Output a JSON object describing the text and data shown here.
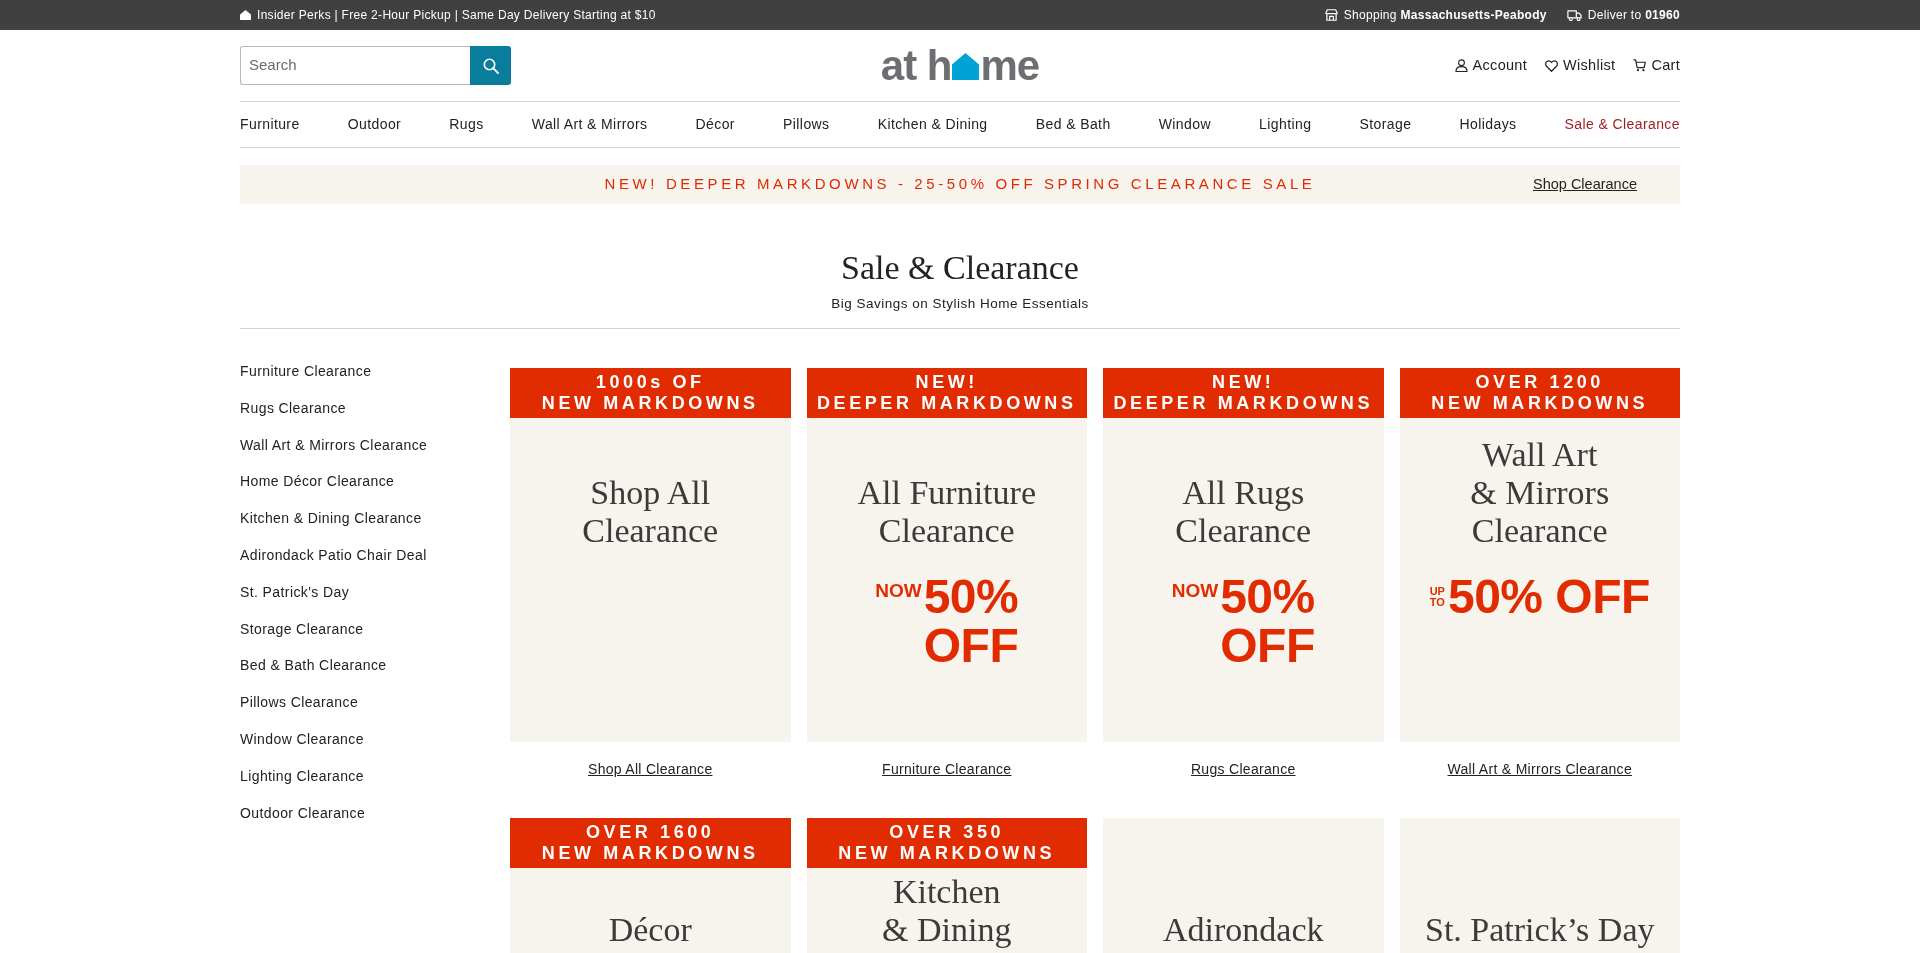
{
  "top_bar": {
    "promo": "Insider Perks | Free 2-Hour Pickup | Same Day Delivery Starting at $10",
    "store": "Shopping **Massachusetts-Peabody**",
    "delivery": "Deliver to **01960**"
  },
  "header": {
    "search": {
      "placeholder": "Search"
    },
    "logo": {
      "text_before": "at h",
      "text_after": "me"
    },
    "account_links": [
      {
        "kind": "account",
        "label": "Account"
      },
      {
        "kind": "wishlist",
        "label": "Wishlist"
      },
      {
        "kind": "cart",
        "label": "Cart"
      }
    ]
  },
  "nav": [
    {
      "label": "Furniture",
      "selected": false
    },
    {
      "label": "Outdoor",
      "selected": false
    },
    {
      "label": "Rugs",
      "selected": false
    },
    {
      "label": "Wall Art & Mirrors",
      "selected": false
    },
    {
      "label": "Décor",
      "selected": false
    },
    {
      "label": "Pillows",
      "selected": false
    },
    {
      "label": "Kitchen & Dining",
      "selected": false
    },
    {
      "label": "Bed & Bath",
      "selected": false
    },
    {
      "label": "Window",
      "selected": false
    },
    {
      "label": "Lighting",
      "selected": false
    },
    {
      "label": "Storage",
      "selected": false
    },
    {
      "label": "Holidays",
      "selected": false
    },
    {
      "label": "Sale & Clearance",
      "selected": true
    }
  ],
  "promo_banner": {
    "message": "NEW! DEEPER MARKDOWNS - 25-50% OFF SPRING CLEARANCE SALE",
    "link": "Shop Clearance"
  },
  "page_header": {
    "title": "Sale & Clearance",
    "subtitle": "Big Savings on Stylish Home Essentials"
  },
  "sidebar": {
    "items": [
      "Furniture Clearance",
      "Rugs Clearance",
      "Wall Art & Mirrors Clearance",
      "Home Décor Clearance",
      "Kitchen & Dining Clearance",
      "Adirondack Patio Chair Deal",
      "St. Patrick's Day",
      "Storage Clearance",
      "Bed & Bath Clearance",
      "Pillows Clearance",
      "Window Clearance",
      "Lighting Clearance",
      "Outdoor Clearance"
    ]
  },
  "card_rows": [
    [
      {
        "badge_lines": [
          "1000s OF",
          "NEW MARKDOWNS"
        ],
        "title_lines": [
          "Shop All",
          "Clearance"
        ],
        "link": "Shop All Clearance"
      },
      {
        "badge_lines": [
          "NEW!",
          "DEEPER MARKDOWNS"
        ],
        "title_lines": [
          "All Furniture",
          "Clearance"
        ],
        "offer": {
          "prefix_lines": [
            "NOW"
          ],
          "lines": [
            "50%",
            "OFF"
          ]
        },
        "link": "Furniture Clearance"
      },
      {
        "badge_lines": [
          "NEW!",
          "DEEPER MARKDOWNS"
        ],
        "title_lines": [
          "All Rugs",
          "Clearance"
        ],
        "offer": {
          "prefix_lines": [
            "NOW"
          ],
          "lines": [
            "50%",
            "OFF"
          ]
        },
        "link": "Rugs Clearance"
      },
      {
        "badge_lines": [
          "OVER 1200",
          "NEW MARKDOWNS"
        ],
        "title_lines": [
          "Wall Art",
          "& Mirrors",
          "Clearance"
        ],
        "offer": {
          "prefix_lines": [
            "UP",
            "TO"
          ],
          "lines": [
            "50% OFF"
          ]
        },
        "link": "Wall Art & Mirrors Clearance"
      }
    ],
    [
      {
        "badge_lines": [
          "OVER 1600",
          "NEW MARKDOWNS"
        ],
        "title_lines": [
          "Décor"
        ]
      },
      {
        "badge_lines": [
          "OVER 350",
          "NEW MARKDOWNS"
        ],
        "title_lines": [
          "Kitchen",
          "& Dining"
        ]
      },
      {
        "title_lines": [
          "Adirondack"
        ]
      },
      {
        "title_lines": [
          "St. Patrick’s Day"
        ]
      }
    ]
  ]
}
